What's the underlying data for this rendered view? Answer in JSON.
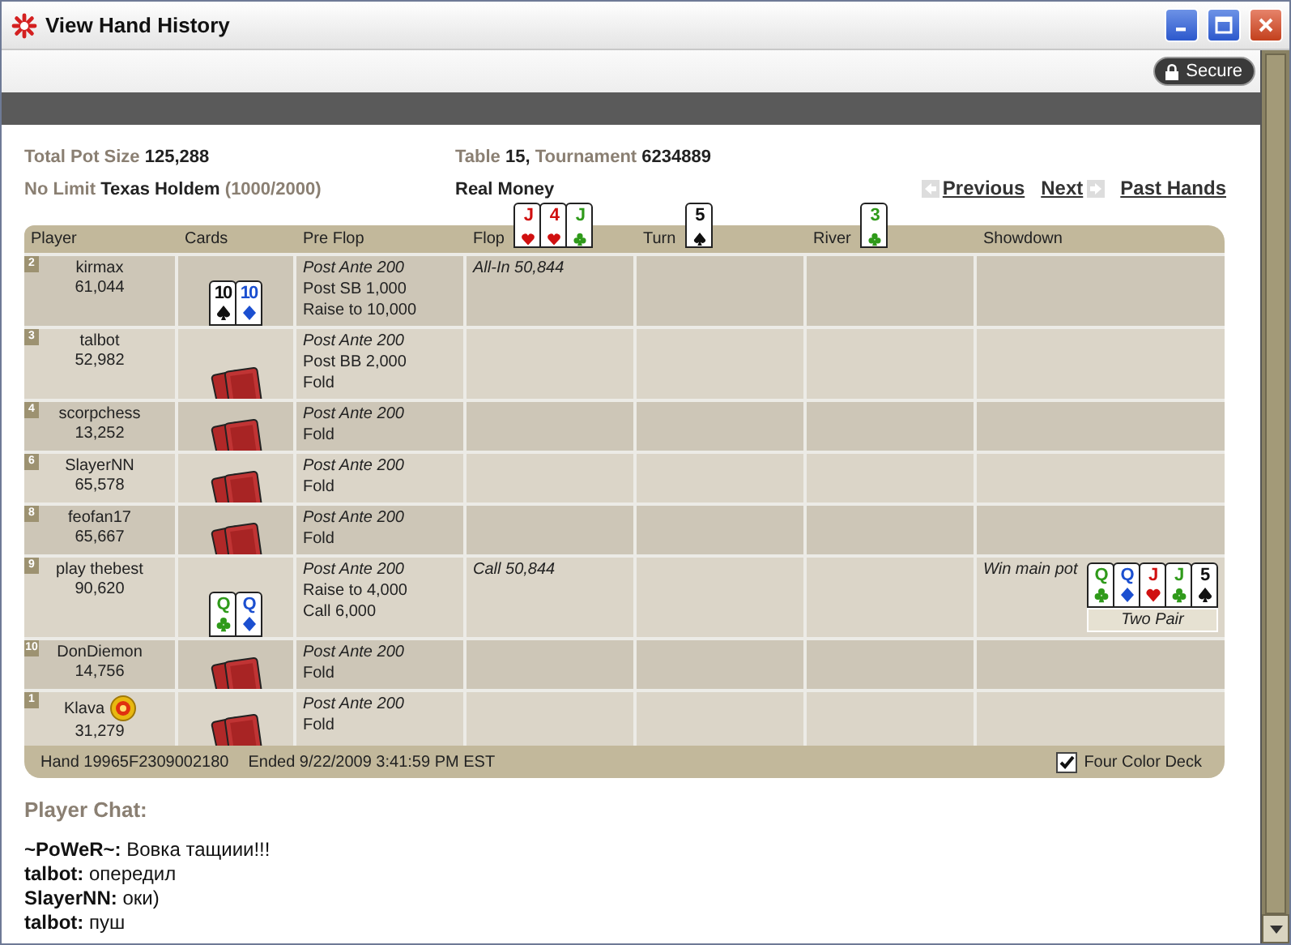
{
  "window": {
    "title": "View Hand History"
  },
  "toolbar": {
    "secure": "Secure"
  },
  "summary": {
    "pot_label": "Total Pot Size",
    "pot": "125,288",
    "game_label": "No Limit",
    "game": "Texas Holdem",
    "stakes": "(1000/2000)",
    "table_label": "Table",
    "table": "15,",
    "tournament_label": "Tournament",
    "tournament": "6234889",
    "money": "Real Money"
  },
  "nav": {
    "previous": "Previous",
    "next": "Next",
    "past": "Past Hands"
  },
  "table": {
    "columns": [
      {
        "label": "Player"
      },
      {
        "label": "Cards"
      },
      {
        "label": "Pre Flop"
      },
      {
        "label": "Flop",
        "cards": [
          {
            "rank": "J",
            "kind": "hearts"
          },
          {
            "rank": "4",
            "kind": "hearts"
          },
          {
            "rank": "J",
            "kind": "clubs"
          }
        ]
      },
      {
        "label": "Turn",
        "cards": [
          {
            "rank": "5",
            "kind": "spades"
          }
        ]
      },
      {
        "label": "River",
        "cards": [
          {
            "rank": "3",
            "kind": "clubs"
          }
        ]
      },
      {
        "label": "Showdown"
      }
    ],
    "rows": [
      {
        "seat": "2",
        "name": "kirmax",
        "stack": "61,044",
        "dealer": false,
        "mucked": false,
        "cards": [
          {
            "rank": "10",
            "kind": "spades"
          },
          {
            "rank": "10",
            "kind": "diamonds"
          }
        ],
        "preflop": [
          {
            "text": "Post Ante 200",
            "italic": true
          },
          {
            "text": "Post SB 1,000",
            "italic": false
          },
          {
            "text": "Raise to 10,000",
            "italic": false
          }
        ],
        "flop": [
          {
            "text": "All-In 50,844",
            "italic": true
          }
        ]
      },
      {
        "seat": "3",
        "name": "talbot",
        "stack": "52,982",
        "dealer": false,
        "mucked": true,
        "preflop": [
          {
            "text": "Post Ante 200",
            "italic": true
          },
          {
            "text": "Post BB 2,000",
            "italic": false
          },
          {
            "text": "Fold",
            "italic": false
          }
        ]
      },
      {
        "seat": "4",
        "name": "scorpchess",
        "stack": "13,252",
        "dealer": false,
        "mucked": true,
        "preflop": [
          {
            "text": "Post Ante 200",
            "italic": true
          },
          {
            "text": "Fold",
            "italic": false
          }
        ]
      },
      {
        "seat": "6",
        "name": "SlayerNN",
        "stack": "65,578",
        "dealer": false,
        "mucked": true,
        "preflop": [
          {
            "text": "Post Ante 200",
            "italic": true
          },
          {
            "text": "Fold",
            "italic": false
          }
        ]
      },
      {
        "seat": "8",
        "name": "feofan17",
        "stack": "65,667",
        "dealer": false,
        "mucked": true,
        "preflop": [
          {
            "text": "Post Ante 200",
            "italic": true
          },
          {
            "text": "Fold",
            "italic": false
          }
        ]
      },
      {
        "seat": "9",
        "name": "play thebest",
        "stack": "90,620",
        "dealer": false,
        "mucked": false,
        "cards": [
          {
            "rank": "Q",
            "kind": "clubs"
          },
          {
            "rank": "Q",
            "kind": "diamonds"
          }
        ],
        "preflop": [
          {
            "text": "Post Ante 200",
            "italic": true
          },
          {
            "text": "Raise to 4,000",
            "italic": false
          },
          {
            "text": "Call 6,000",
            "italic": false
          }
        ],
        "flop": [
          {
            "text": "Call 50,844",
            "italic": true
          }
        ],
        "showdown": {
          "text": "Win main pot",
          "cards": [
            {
              "rank": "Q",
              "kind": "clubs"
            },
            {
              "rank": "Q",
              "kind": "diamonds"
            },
            {
              "rank": "J",
              "kind": "hearts"
            },
            {
              "rank": "J",
              "kind": "clubs"
            },
            {
              "rank": "5",
              "kind": "spades"
            }
          ],
          "hand": "Two Pair"
        }
      },
      {
        "seat": "10",
        "name": "DonDiemon",
        "stack": "14,756",
        "dealer": false,
        "mucked": true,
        "preflop": [
          {
            "text": "Post Ante 200",
            "italic": true
          },
          {
            "text": "Fold",
            "italic": false
          }
        ]
      },
      {
        "seat": "1",
        "name": "Klava",
        "stack": "31,279",
        "dealer": true,
        "mucked": true,
        "preflop": [
          {
            "text": "Post Ante 200",
            "italic": true
          },
          {
            "text": "Fold",
            "italic": false
          }
        ]
      }
    ],
    "footer": {
      "hand": "Hand 19965F2309002180",
      "ended": "Ended 9/22/2009 3:41:59 PM EST",
      "four_color": {
        "label": "Four Color Deck",
        "checked": true
      }
    }
  },
  "chat": {
    "title": "Player Chat:",
    "messages": [
      "**~PoWeR~:** Вовка тащиии!!!",
      "**talbot:** опередил",
      "**SlayerNN:** оки)",
      "**talbot:** пуш"
    ]
  }
}
